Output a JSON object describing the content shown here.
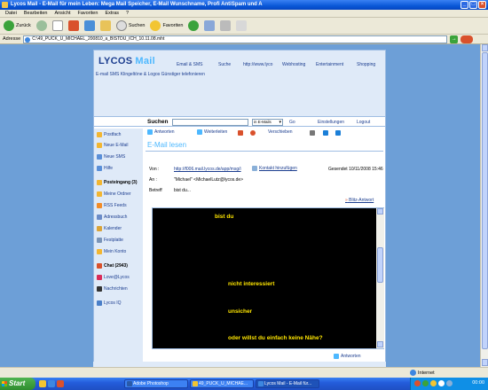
{
  "window": {
    "title": "Lycos Mail - E-Mail für mein Leben: Mega Mail Speicher, E-Mail Wunschname, Profi AntiSpam und A"
  },
  "menubar": [
    "Datei",
    "Bearbeiten",
    "Ansicht",
    "Favoriten",
    "Extras",
    "?"
  ],
  "toolbar": {
    "back": "Zurück",
    "search": "Suchen",
    "favorites": "Favoriten"
  },
  "addressbar": {
    "label": "Adresse",
    "url": "C:\\49_PUCK_U_MICHAEL_200810_a_BISTDU_ICH_10.11.08.mht"
  },
  "lycos": {
    "logo": "LYCOS",
    "logo_mail": "Mail",
    "nav": [
      "Email & SMS",
      "Suche",
      "http://www.lyco",
      "Webhosting",
      "Entertainment",
      "Shopping"
    ],
    "subnav": "E-mail  SMS  Klingeltöne & Logos  Günstiger telefonieren"
  },
  "searchbar": {
    "label": "Suchen",
    "scope": "in E-Mails",
    "go": "Go",
    "settings": "Einstellungen",
    "logout": "Logout"
  },
  "sidebar": {
    "items": [
      {
        "label": "Postfach",
        "color": "#f2b632"
      },
      {
        "label": "Neue E-Mail",
        "color": "#f2b632"
      },
      {
        "label": "Neue SMS",
        "color": "#5a8fd8"
      },
      {
        "label": "Hilfe",
        "color": "#5a8fd8"
      },
      {
        "label": "Posteingang (3)",
        "color": "#f2b632",
        "bold": true
      },
      {
        "label": "Meine Ordner",
        "color": "#f2b632"
      },
      {
        "label": "RSS Feeds",
        "color": "#f28c28"
      },
      {
        "label": "Adressbuch",
        "color": "#6b8cc8"
      },
      {
        "label": "Kalender",
        "color": "#d9a43a"
      },
      {
        "label": "Festplatte",
        "color": "#7b95b8"
      },
      {
        "label": "Mein Konto",
        "color": "#f2b632"
      },
      {
        "label": "Chat (2943)",
        "color": "#d9512c",
        "bold": true
      },
      {
        "label": "Love@Lycos",
        "color": "#d92c5a"
      },
      {
        "label": "Nachrichten",
        "color": "#333333"
      },
      {
        "label": "Lycos IQ",
        "color": "#4a7fc8"
      }
    ]
  },
  "mailtoolbar": {
    "reply": "Antworten",
    "forward": "Weiterleiten",
    "move": "Verschieben"
  },
  "mail": {
    "title": "E-Mail lesen",
    "from_label": "Von :",
    "from_value": "http://f006.mail.lycos.de/app/msg/i",
    "add_contact": "Kontakt hinzufügen",
    "sent": "Gesendet 10/11/2008 15:46",
    "to_label": "An :",
    "to_value": "\"Michael\" <MichaelLutz@lycos.de>",
    "subject_label": "Betreff",
    "subject_value": "bist du...",
    "quick_reply": "Blitz-Antwort",
    "body_lines": [
      "bist du",
      "nicht interessiert",
      "unsicher",
      "oder willst du einfach keine Nähe?"
    ],
    "bottom_reply": "Antworten"
  },
  "statusbar": {
    "zone": "Internet"
  },
  "taskbar": {
    "start": "Start",
    "tasks": [
      "Adobe Photoshop",
      "49_PUCK_U_MICHAE...",
      "Lycos Mail - E-Mail für..."
    ],
    "clock": "00:00"
  }
}
